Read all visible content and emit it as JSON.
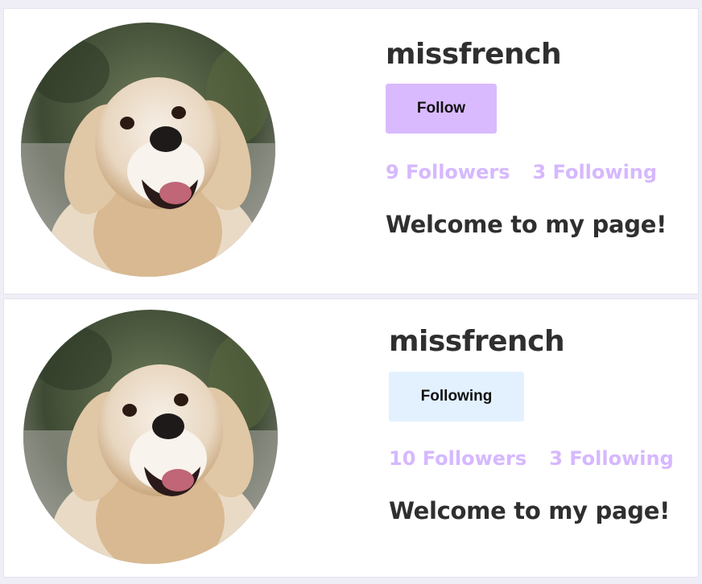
{
  "profiles": [
    {
      "username": "missfrench",
      "follow_button_label": "Follow",
      "followers_text": "9 Followers",
      "following_text": "3 Following",
      "bio": "Welcome to my page!",
      "button_color": "#d9baff"
    },
    {
      "username": "missfrench",
      "follow_button_label": "Following",
      "followers_text": "10 Followers",
      "following_text": "3 Following",
      "bio": "Welcome to my page!",
      "button_color": "#e3f1ff"
    }
  ],
  "colors": {
    "stats_text": "#d6b8ff",
    "heading_text": "#2f2f2f",
    "card_background": "#ffffff",
    "page_background": "#efedf6"
  }
}
